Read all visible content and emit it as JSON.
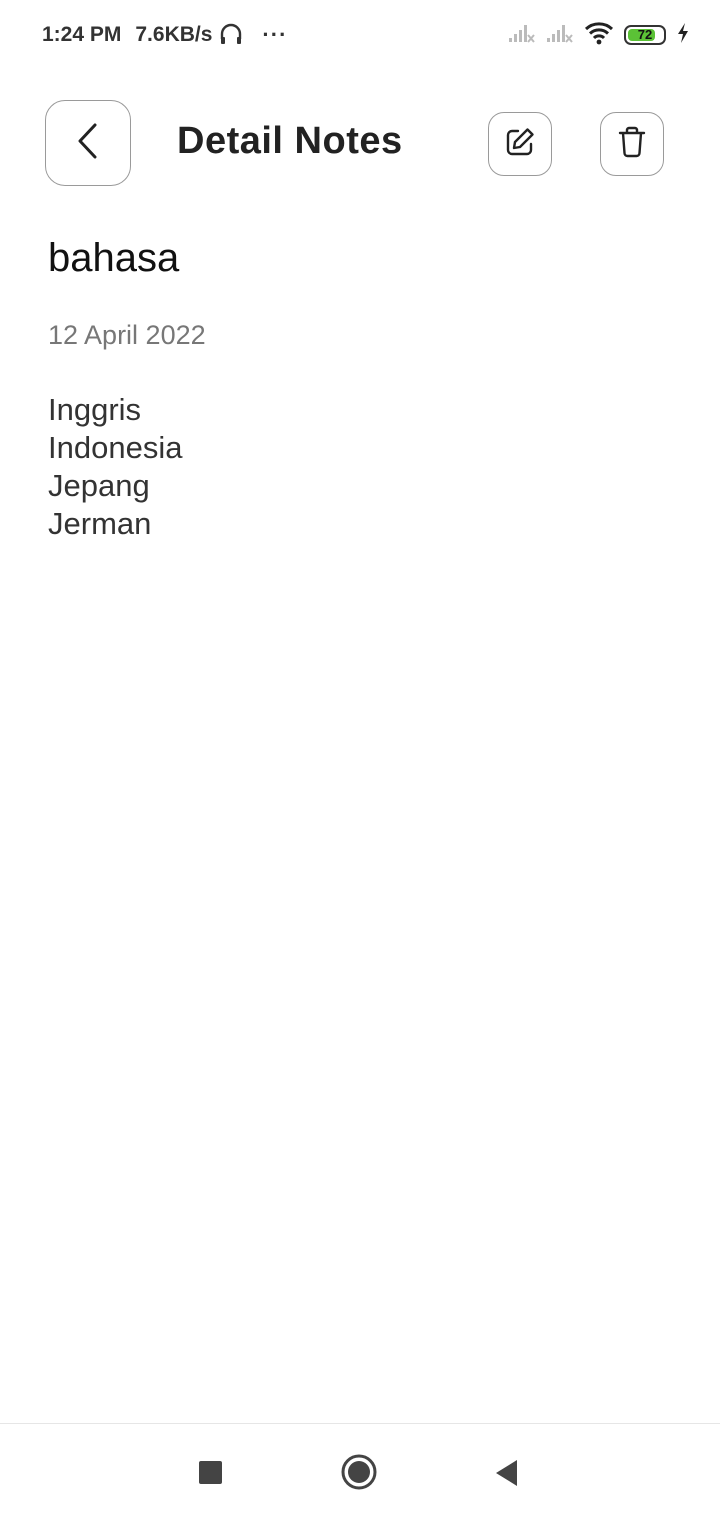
{
  "status_bar": {
    "time": "1:24 PM",
    "net_speed": "7.6KB/s",
    "more": "···",
    "battery_level": "72",
    "icons": [
      "headset-icon",
      "signal-icon",
      "signal-icon",
      "wifi-icon",
      "battery-icon",
      "charging-icon"
    ],
    "battery_color": "#5bc236"
  },
  "header": {
    "title": "Detail Notes",
    "back_icon": "chevron-left-icon",
    "edit_icon": "edit-icon",
    "delete_icon": "trash-icon"
  },
  "note": {
    "title": "bahasa",
    "date": "12 April 2022",
    "lines": [
      "Inggris",
      "Indonesia",
      "Jepang",
      "Jerman"
    ]
  },
  "nav_bar": {
    "icons": [
      "recents-icon",
      "home-icon",
      "back-icon"
    ]
  }
}
